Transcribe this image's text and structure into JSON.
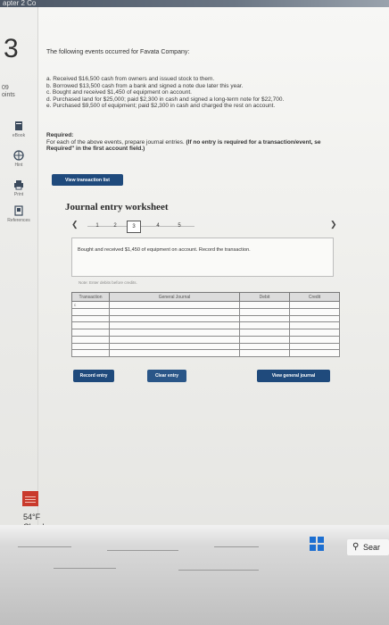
{
  "browser": {
    "title_fragment": "apter 2 Co"
  },
  "question": {
    "number": "3",
    "points_value": "09",
    "points_label": "oints",
    "intro": "The following events occurred for Favata Company:",
    "events": [
      "a. Received $16,500 cash from owners and issued stock to them.",
      "b. Borrowed $13,500 cash from a bank and signed a note due later this year.",
      "c. Bought and received $1,450 of equipment on account.",
      "d. Purchased land for $25,000; paid $2,300 in cash and signed a long-term note for $22,700.",
      "e. Purchased $9,500 of equipment; paid $2,300 in cash and charged the rest on account."
    ],
    "required_label": "Required:",
    "required_text": "For each of the above events, prepare journal entries.",
    "required_bold": "(If no entry is required for a transaction/event, se",
    "required_line2": "Required\" in the first account field.)"
  },
  "rail": {
    "ebook": "eBook",
    "hint": "Hint",
    "print": "Print",
    "references": "References"
  },
  "buttons": {
    "view_transaction_list": "View transaction list",
    "record_entry": "Record entry",
    "clear_entry": "Clear entry",
    "view_general_journal": "View general journal"
  },
  "worksheet": {
    "title": "Journal entry worksheet",
    "pages": [
      "1",
      "2",
      "3",
      "4",
      "5"
    ],
    "active_page": "3",
    "prompt": "Bought and received $1,450 of equipment on account. Record the transaction.",
    "note": "Note: Enter debits before credits.",
    "columns": [
      "Transaction",
      "General Journal",
      "Debit",
      "Credit"
    ],
    "first_transaction": "c"
  },
  "weather": {
    "temp": "54°F",
    "condition": "Cloudy"
  },
  "taskbar": {
    "search_label": "Sear"
  },
  "colors": {
    "button_blue": "#1f4a7c",
    "app_red": "#c93a2c",
    "windows_blue": "#1d6fd1"
  }
}
